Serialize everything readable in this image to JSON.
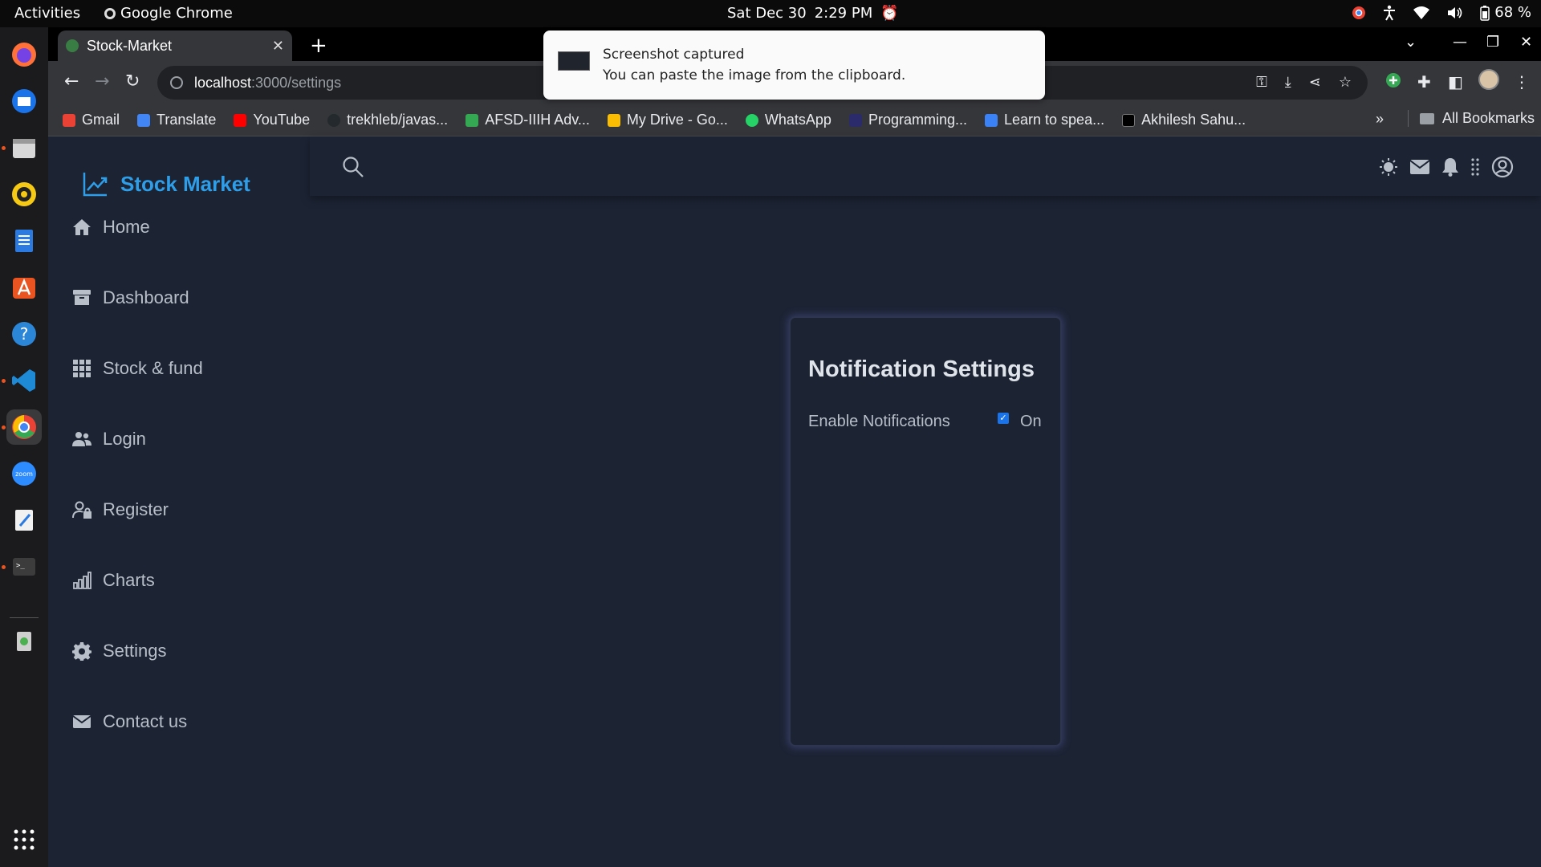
{
  "system": {
    "activities": "Activities",
    "app_name": "Google Chrome",
    "date": "Sat Dec 30",
    "time": "2:29 PM",
    "battery": "68 %"
  },
  "browser": {
    "tab_title": "Stock-Market",
    "url_host": "localhost",
    "url_path": ":3000/settings",
    "bookmarks": [
      {
        "label": "Gmail",
        "color": "#ea4335"
      },
      {
        "label": "Translate",
        "color": "#4285f4"
      },
      {
        "label": "YouTube",
        "color": "#ff0000"
      },
      {
        "label": "trekhleb/javas...",
        "color": "#24292e"
      },
      {
        "label": "AFSD-IIIH Adv...",
        "color": "#34a853"
      },
      {
        "label": "My Drive - Go...",
        "color": "#fbbc04"
      },
      {
        "label": "WhatsApp",
        "color": "#25d366"
      },
      {
        "label": "Programming...",
        "color": "#2b2b6b"
      },
      {
        "label": "Learn to spea...",
        "color": "#3b82f6"
      },
      {
        "label": "Akhilesh Sahu...",
        "color": "#000000"
      }
    ],
    "more": "»",
    "all_bookmarks": "All Bookmarks"
  },
  "notification": {
    "title": "Screenshot captured",
    "body": "You can paste the image from the clipboard."
  },
  "app": {
    "brand": "Stock Market",
    "brand_color": "#2f9ee8",
    "nav": [
      {
        "label": "Home",
        "icon": "home-icon"
      },
      {
        "label": "Dashboard",
        "icon": "archive-icon"
      },
      {
        "label": "Stock & fund",
        "icon": "grid-icon"
      },
      {
        "label": "Login",
        "icon": "users-icon"
      },
      {
        "label": "Register",
        "icon": "user-lock-icon"
      },
      {
        "label": "Charts",
        "icon": "bar-chart-icon"
      },
      {
        "label": "Settings",
        "icon": "gear-icon"
      },
      {
        "label": "Contact us",
        "icon": "envelope-icon"
      }
    ],
    "settings_card": {
      "title": "Notification Settings",
      "enable_label": "Enable Notifications",
      "enabled": true,
      "state_text": "On"
    }
  }
}
